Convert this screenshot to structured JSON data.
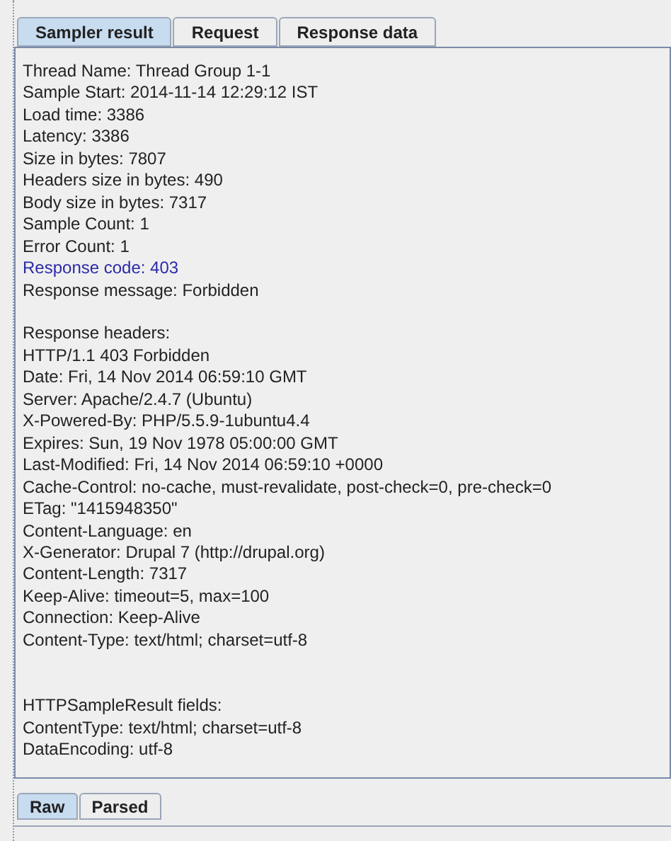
{
  "tabs": [
    {
      "label": "Sampler result",
      "selected": true
    },
    {
      "label": "Request",
      "selected": false
    },
    {
      "label": "Response data",
      "selected": false
    }
  ],
  "lines": [
    {
      "kind": "text",
      "text": "Thread Name: Thread Group 1-1"
    },
    {
      "kind": "text",
      "text": "Sample Start: 2014-11-14 12:29:12 IST"
    },
    {
      "kind": "text",
      "text": "Load time: 3386"
    },
    {
      "kind": "text",
      "text": "Latency: 3386"
    },
    {
      "kind": "text",
      "text": "Size in bytes: 7807"
    },
    {
      "kind": "text",
      "text": "Headers size in bytes: 490"
    },
    {
      "kind": "text",
      "text": "Body size in bytes: 7317"
    },
    {
      "kind": "text",
      "text": "Sample Count: 1"
    },
    {
      "kind": "text",
      "text": "Error Count: 1"
    },
    {
      "kind": "highlight",
      "text": "Response code: 403"
    },
    {
      "kind": "text",
      "text": "Response message: Forbidden"
    },
    {
      "kind": "blank"
    },
    {
      "kind": "text",
      "text": "Response headers:"
    },
    {
      "kind": "text",
      "text": "HTTP/1.1 403 Forbidden"
    },
    {
      "kind": "text",
      "text": "Date: Fri, 14 Nov 2014 06:59:10 GMT"
    },
    {
      "kind": "text",
      "text": "Server: Apache/2.4.7 (Ubuntu)"
    },
    {
      "kind": "text",
      "text": "X-Powered-By: PHP/5.5.9-1ubuntu4.4"
    },
    {
      "kind": "text",
      "text": "Expires: Sun, 19 Nov 1978 05:00:00 GMT"
    },
    {
      "kind": "text",
      "text": "Last-Modified: Fri, 14 Nov 2014 06:59:10 +0000"
    },
    {
      "kind": "text",
      "text": "Cache-Control: no-cache, must-revalidate, post-check=0, pre-check=0"
    },
    {
      "kind": "text",
      "text": "ETag: \"1415948350\""
    },
    {
      "kind": "text",
      "text": "Content-Language: en"
    },
    {
      "kind": "text",
      "text": "X-Generator: Drupal 7 (http://drupal.org)"
    },
    {
      "kind": "text",
      "text": "Content-Length: 7317"
    },
    {
      "kind": "text",
      "text": "Keep-Alive: timeout=5, max=100"
    },
    {
      "kind": "text",
      "text": "Connection: Keep-Alive"
    },
    {
      "kind": "text",
      "text": "Content-Type: text/html; charset=utf-8"
    },
    {
      "kind": "blank"
    },
    {
      "kind": "blank"
    },
    {
      "kind": "text",
      "text": "HTTPSampleResult fields:"
    },
    {
      "kind": "text",
      "text": "ContentType: text/html; charset=utf-8"
    },
    {
      "kind": "text",
      "text": "DataEncoding: utf-8"
    }
  ],
  "bottom_tabs": [
    {
      "label": "Raw",
      "selected": true
    },
    {
      "label": "Parsed",
      "selected": false
    }
  ]
}
